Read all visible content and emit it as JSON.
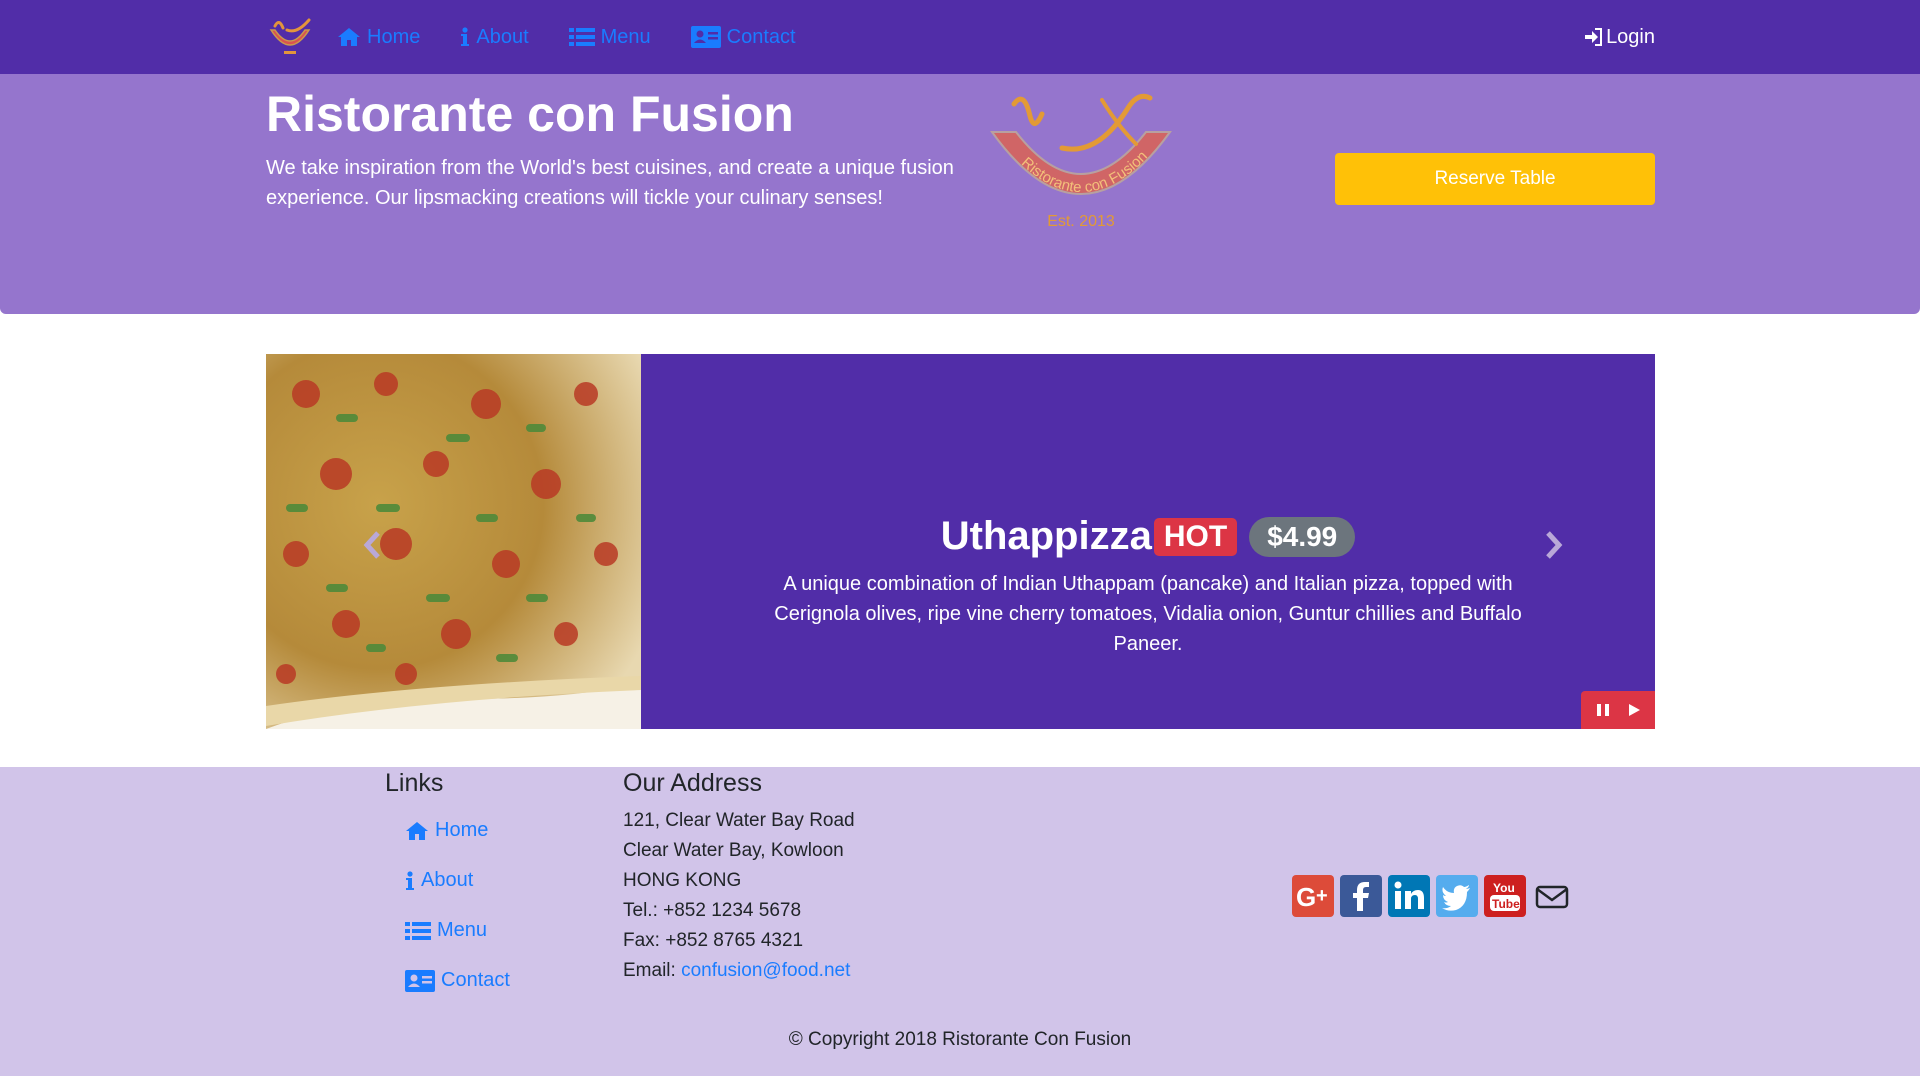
{
  "navbar": {
    "links": [
      {
        "label": "Home",
        "icon": "home-icon"
      },
      {
        "label": "About",
        "icon": "info-icon"
      },
      {
        "label": "Menu",
        "icon": "list-icon"
      },
      {
        "label": "Contact",
        "icon": "address-card-icon"
      }
    ],
    "login_label": "Login"
  },
  "jumbotron": {
    "title": "Ristorante con Fusion",
    "text": "We take inspiration from the World's best cuisines, and create a unique fusion experience. Our lipsmacking creations will tickle your culinary senses!",
    "reserve_label": "Reserve Table",
    "logo_text": "Ristorante con Fusion",
    "logo_est": "Est. 2013"
  },
  "carousel": {
    "name": "Uthappizza",
    "badge": "HOT",
    "price": "$4.99",
    "description": "A unique combination of Indian Uthappam (pancake) and Italian pizza, topped with Cerignola olives, ripe vine cherry tomatoes, Vidalia onion, Guntur chillies and Buffalo Paneer."
  },
  "footer": {
    "links_heading": "Links",
    "links": [
      "Home",
      "About",
      "Menu",
      "Contact"
    ],
    "address_heading": "Our Address",
    "address_lines": [
      "121, Clear Water Bay Road",
      "Clear Water Bay, Kowloon",
      "HONG KONG",
      "Tel.: +852 1234 5678",
      "Fax: +852 8765 4321"
    ],
    "email_label": "Email: ",
    "email": "confusion@food.net",
    "social": [
      "google-plus-icon",
      "facebook-icon",
      "linkedin-icon",
      "twitter-icon",
      "youtube-icon",
      "envelope-icon"
    ],
    "copyright": "© Copyright 2018 Ristorante Con Fusion"
  },
  "colors": {
    "primary": "#512DA8",
    "jumbotron": "#9575CD",
    "footer": "#D1C4E9",
    "reserve": "#FFC107",
    "hot": "#dc3545",
    "price": "#6c757d",
    "link": "#1a7cff"
  }
}
